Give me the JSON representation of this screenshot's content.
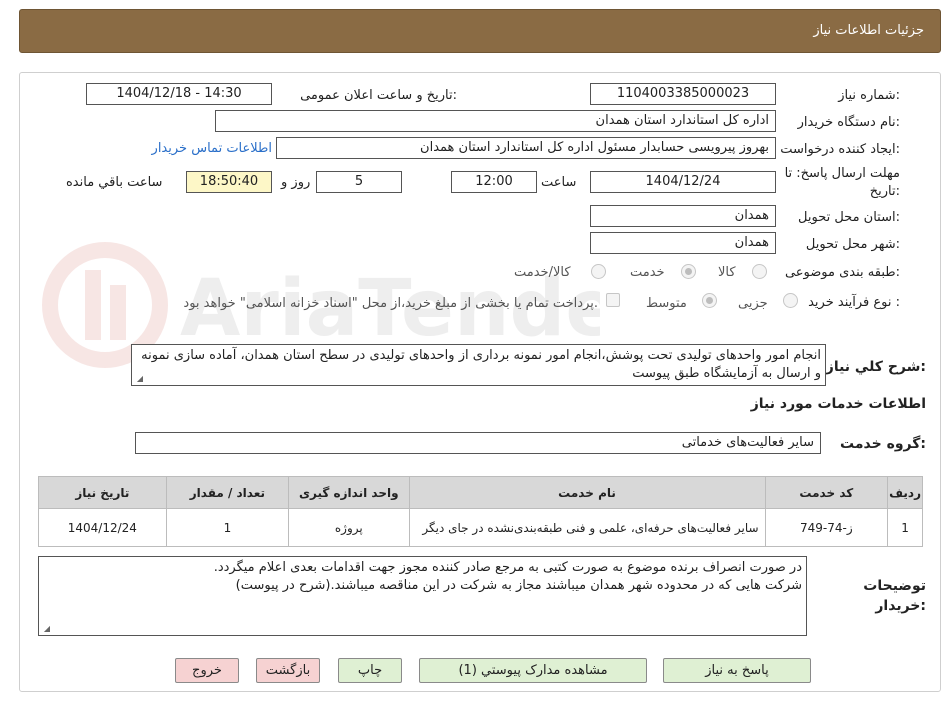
{
  "header": {
    "title": "جزئیات اطلاعات نیاز"
  },
  "fields": {
    "need_number_label": "شماره نیاز:",
    "need_number": "1104003385000023",
    "announce_label": "تاریخ و ساعت اعلان عمومی:",
    "announce_value": "1404/12/18 - 14:30",
    "buyer_org_label": "نام دستگاه خریدار:",
    "buyer_org": "اداره کل استاندارد استان همدان",
    "creator_label": "ایجاد کننده درخواست:",
    "creator": "بهروز پیرویسی حسابدار مسئول اداره کل استاندارد استان همدان",
    "contact_link": "اطلاعات تماس خریدار",
    "deadline_label_1": "مهلت ارسال پاسخ: تا",
    "deadline_label_2": "تاریخ:",
    "deadline_date": "1404/12/24",
    "time_label": "ساعت",
    "deadline_time": "12:00",
    "days_value": "5",
    "days_label": "روز و",
    "remaining_time": "18:50:40",
    "remaining_label": "ساعت باقي مانده",
    "province_label": "استان محل تحویل:",
    "province": "همدان",
    "city_label": "شهر محل تحویل:",
    "city": "همدان",
    "category_label": "طبقه بندی موضوعی:",
    "category_options": [
      "کالا",
      "خدمت",
      "کالا/خدمت"
    ],
    "category_selected": "خدمت",
    "process_label": "نوع فرآیند خرید :",
    "process_options": [
      "جزیی",
      "متوسط"
    ],
    "process_selected": "متوسط",
    "payment_note": "پرداخت تمام یا بخشی از مبلغ خرید،از محل \"اسناد خزانه اسلامی\" خواهد بود.",
    "description_label": "شرح کلي نياز:",
    "description": "انجام  امور واحدهای تولیدی تحت پوشش،انجام امور نمونه برداری از واحدهای تولیدی در سطح استان همدان، آماده سازی نمونه و ارسال به آزمایشگاه طبق پیوست",
    "services_section": "اطلاعات خدمات مورد نیاز",
    "service_group_label": "گروه خدمت:",
    "service_group": "سایر فعالیت‌های خدماتی"
  },
  "table": {
    "headers": [
      "ردیف",
      "کد خدمت",
      "نام خدمت",
      "واحد اندازه گیری",
      "تعداد / مقدار",
      "تاریخ نیاز"
    ],
    "rows": [
      [
        "1",
        "ز-74-749",
        "سایر فعالیت‌های حرفه‌ای، علمی و فنی طبقه‌بندی‌نشده در جای دیگر",
        "پروژه",
        "1",
        "1404/12/24"
      ]
    ]
  },
  "buyer_notes": {
    "label_1": "توضیحات",
    "label_2": "خریدار:",
    "line_1": "در صورت انصراف برنده موضوع به صورت کتبی به مرجع صادر کننده مجوز جهت اقدامات بعدی اعلام میگردد.",
    "line_2": "شرکت هایی که در محدوده شهر همدان میباشند مجاز به شرکت در این مناقصه میباشند.(شرح در پیوست)"
  },
  "buttons": {
    "reply": "پاسخ به نیاز",
    "attachments": "مشاهده مدارک پیوستي (1)",
    "print": "چاپ",
    "back": "بازگشت",
    "exit": "خروج"
  },
  "colors": {
    "header_bg": "#8a6b44",
    "link": "#2a6fc9",
    "remaining_bg": "#fdf7c7",
    "button_green": "#dff0d3",
    "button_pink": "#f6d2d2"
  }
}
